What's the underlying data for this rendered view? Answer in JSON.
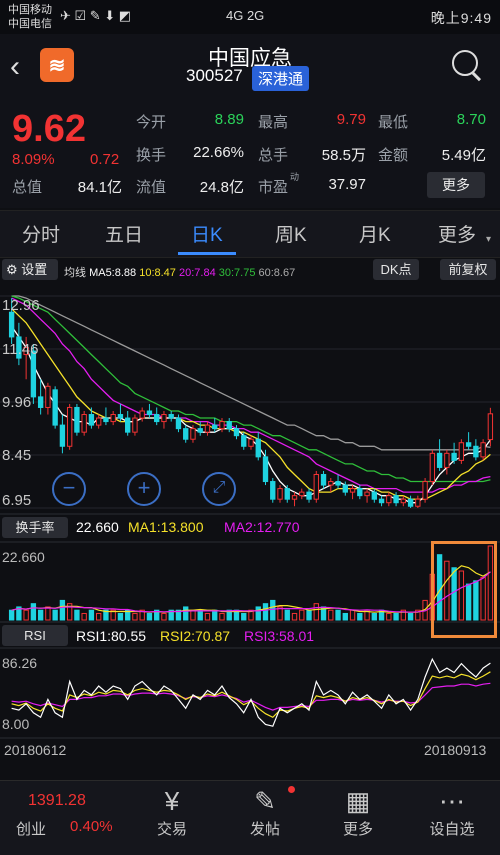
{
  "status_bar": {
    "carrier1": "中国移动",
    "carrier2": "中国电信",
    "time": "晚上9:49",
    "signal": "4G  2G",
    "icons": "✈ ☑ ✎ ⬇ ◩"
  },
  "header": {
    "stock_name": "中国应急",
    "stock_code": "300527",
    "badge": "深港通",
    "logo_text": "≋"
  },
  "quote": {
    "price": "9.62",
    "change_pct": "8.09%",
    "change": "0.72",
    "fields": [
      {
        "label": "今开",
        "value": "8.89",
        "color": "green"
      },
      {
        "label": "最高",
        "value": "9.79",
        "color": "red"
      },
      {
        "label": "最低",
        "value": "8.70",
        "color": "green"
      },
      {
        "label": "换手",
        "value": "22.66%",
        "color": ""
      },
      {
        "label": "总手",
        "value": "58.5万",
        "color": ""
      },
      {
        "label": "金额",
        "value": "5.49亿",
        "color": ""
      },
      {
        "label": "总值",
        "value": "84.1亿",
        "color": ""
      },
      {
        "label": "流值",
        "value": "24.8亿",
        "color": ""
      },
      {
        "label": "市盈",
        "value": "37.97",
        "color": ""
      }
    ],
    "pe_sup": "动",
    "more_button": "更多"
  },
  "tabs": [
    "分时",
    "五日",
    "日K",
    "周K",
    "月K",
    "更多"
  ],
  "active_tab": "日K",
  "ma_bar": {
    "settings": "设置",
    "legend_label": "均线",
    "ma5": "MA5:8.88",
    "ma10": "10:8.47",
    "ma20": "20:7.84",
    "ma30": "30:7.75",
    "ma60": "60:8.67",
    "dk_button": "DK点",
    "fq_button": "前复权"
  },
  "colors": {
    "ma5": "#ffffff",
    "ma10": "#f5e12a",
    "ma20": "#e41ef0",
    "ma30": "#2fbf3a",
    "ma60": "#9a9a9a",
    "up": "#f23333",
    "down": "#1fd3e0",
    "highlight": "#f08a3a"
  },
  "main_chart": {
    "y_labels": [
      "12.96",
      "11.46",
      "9.96",
      "8.45",
      "6.95"
    ]
  },
  "turnover": {
    "button": "换手率",
    "value": "22.660",
    "ma1": "MA1:13.800",
    "ma2": "MA2:12.770",
    "y_label": "22.660"
  },
  "rsi": {
    "button": "RSI",
    "rsi1": "RSI1:80.55",
    "rsi2": "RSI2:70.87",
    "rsi3": "RSI3:58.01",
    "y_top": "86.26",
    "y_bottom": "8.00"
  },
  "dates": {
    "start": "20180612",
    "end": "20180913"
  },
  "bottom_nav": {
    "index_value": "1391.28",
    "index_name": "创业",
    "index_pct": "0.40%",
    "items": [
      {
        "label": "交易",
        "icon": "¥"
      },
      {
        "label": "发帖",
        "icon": "✎"
      },
      {
        "label": "更多",
        "icon": "▦"
      },
      {
        "label": "设自选",
        "icon": "⋯"
      }
    ]
  },
  "chart_data": {
    "type": "candlestick",
    "title": "",
    "ylim": [
      6.95,
      12.96
    ],
    "candles": [
      [
        12.5,
        12.9,
        11.6,
        11.8
      ],
      [
        11.8,
        12.2,
        11.0,
        11.2
      ],
      [
        11.3,
        11.8,
        10.6,
        11.5
      ],
      [
        11.4,
        11.6,
        9.9,
        10.1
      ],
      [
        10.1,
        10.6,
        9.6,
        9.8
      ],
      [
        9.8,
        10.5,
        9.6,
        10.4
      ],
      [
        10.3,
        10.4,
        9.2,
        9.3
      ],
      [
        9.3,
        9.6,
        8.5,
        8.7
      ],
      [
        8.7,
        9.9,
        8.6,
        9.8
      ],
      [
        9.8,
        9.9,
        9.0,
        9.1
      ],
      [
        9.1,
        9.7,
        9.0,
        9.6
      ],
      [
        9.6,
        9.8,
        9.2,
        9.3
      ],
      [
        9.3,
        9.6,
        9.2,
        9.5
      ],
      [
        9.5,
        9.8,
        9.3,
        9.4
      ],
      [
        9.4,
        9.7,
        9.3,
        9.6
      ],
      [
        9.6,
        9.9,
        9.4,
        9.5
      ],
      [
        9.5,
        9.7,
        9.0,
        9.1
      ],
      [
        9.1,
        9.6,
        9.0,
        9.5
      ],
      [
        9.5,
        9.8,
        9.4,
        9.7
      ],
      [
        9.7,
        9.9,
        9.5,
        9.6
      ],
      [
        9.6,
        9.8,
        9.3,
        9.4
      ],
      [
        9.4,
        9.7,
        9.2,
        9.6
      ],
      [
        9.6,
        9.7,
        9.4,
        9.5
      ],
      [
        9.5,
        9.6,
        9.1,
        9.2
      ],
      [
        9.2,
        9.3,
        8.8,
        8.9
      ],
      [
        8.9,
        9.3,
        8.8,
        9.2
      ],
      [
        9.2,
        9.4,
        9.0,
        9.1
      ],
      [
        9.1,
        9.4,
        9.0,
        9.3
      ],
      [
        9.3,
        9.5,
        9.1,
        9.2
      ],
      [
        9.2,
        9.5,
        9.1,
        9.4
      ],
      [
        9.4,
        9.5,
        9.1,
        9.2
      ],
      [
        9.2,
        9.3,
        8.9,
        9.0
      ],
      [
        9.0,
        9.1,
        8.6,
        8.7
      ],
      [
        8.7,
        9.0,
        8.6,
        8.9
      ],
      [
        8.9,
        9.1,
        8.3,
        8.4
      ],
      [
        8.4,
        8.6,
        7.6,
        7.7
      ],
      [
        7.7,
        7.8,
        7.1,
        7.2
      ],
      [
        7.2,
        7.6,
        7.1,
        7.5
      ],
      [
        7.5,
        7.6,
        7.1,
        7.2
      ],
      [
        7.2,
        7.4,
        7.0,
        7.3
      ],
      [
        7.3,
        7.5,
        7.2,
        7.4
      ],
      [
        7.4,
        7.5,
        7.1,
        7.2
      ],
      [
        7.2,
        8.0,
        7.1,
        7.9
      ],
      [
        7.9,
        8.0,
        7.5,
        7.6
      ],
      [
        7.6,
        7.8,
        7.4,
        7.7
      ],
      [
        7.7,
        7.9,
        7.5,
        7.6
      ],
      [
        7.6,
        7.7,
        7.3,
        7.4
      ],
      [
        7.4,
        7.6,
        7.2,
        7.5
      ],
      [
        7.5,
        7.6,
        7.2,
        7.3
      ],
      [
        7.3,
        7.5,
        7.1,
        7.4
      ],
      [
        7.4,
        7.5,
        7.1,
        7.2
      ],
      [
        7.2,
        7.3,
        7.0,
        7.1
      ],
      [
        7.1,
        7.4,
        7.0,
        7.3
      ],
      [
        7.3,
        7.4,
        7.0,
        7.1
      ],
      [
        7.1,
        7.3,
        7.0,
        7.2
      ],
      [
        7.2,
        7.3,
        6.95,
        7.0
      ],
      [
        7.0,
        7.3,
        6.95,
        7.2
      ],
      [
        7.2,
        7.8,
        7.1,
        7.7
      ],
      [
        7.7,
        8.6,
        7.6,
        8.5
      ],
      [
        8.5,
        8.9,
        8.0,
        8.1
      ],
      [
        8.1,
        8.6,
        7.9,
        8.5
      ],
      [
        8.5,
        8.8,
        8.2,
        8.3
      ],
      [
        8.3,
        8.9,
        8.2,
        8.8
      ],
      [
        8.8,
        9.1,
        8.6,
        8.7
      ],
      [
        8.7,
        8.9,
        8.3,
        8.4
      ],
      [
        8.4,
        8.9,
        8.3,
        8.8
      ],
      [
        8.89,
        9.79,
        8.7,
        9.62
      ]
    ],
    "ma5": [
      12.1,
      11.8,
      11.5,
      11.0,
      10.6,
      10.2,
      9.9,
      9.6,
      9.5,
      9.4,
      9.4,
      9.3,
      9.5,
      9.5,
      9.5,
      9.5,
      9.4,
      9.4,
      9.5,
      9.5,
      9.5,
      9.5,
      9.5,
      9.5,
      9.3,
      9.2,
      9.1,
      9.1,
      9.1,
      9.2,
      9.2,
      9.2,
      9.0,
      8.9,
      8.7,
      8.4,
      8.0,
      7.7,
      7.5,
      7.4,
      7.3,
      7.3,
      7.4,
      7.5,
      7.6,
      7.7,
      7.6,
      7.6,
      7.5,
      7.5,
      7.4,
      7.3,
      7.3,
      7.2,
      7.2,
      7.1,
      7.1,
      7.3,
      7.6,
      7.9,
      8.1,
      8.3,
      8.4,
      8.5,
      8.5,
      8.6,
      8.88
    ],
    "ma10": [
      12.6,
      12.4,
      12.2,
      11.9,
      11.6,
      11.3,
      11.0,
      10.7,
      10.4,
      10.1,
      9.9,
      9.7,
      9.6,
      9.5,
      9.5,
      9.4,
      9.4,
      9.4,
      9.5,
      9.5,
      9.5,
      9.5,
      9.5,
      9.5,
      9.4,
      9.4,
      9.3,
      9.3,
      9.2,
      9.2,
      9.2,
      9.1,
      9.1,
      9.0,
      8.9,
      8.8,
      8.6,
      8.4,
      8.1,
      7.9,
      7.7,
      7.5,
      7.4,
      7.4,
      7.4,
      7.5,
      7.5,
      7.5,
      7.5,
      7.5,
      7.5,
      7.4,
      7.4,
      7.3,
      7.3,
      7.2,
      7.2,
      7.2,
      7.3,
      7.4,
      7.5,
      7.7,
      7.9,
      8.0,
      8.2,
      8.3,
      8.47
    ],
    "ma20": [
      12.9,
      12.8,
      12.7,
      12.5,
      12.3,
      12.1,
      11.9,
      11.6,
      11.4,
      11.1,
      10.9,
      10.6,
      10.4,
      10.2,
      10.0,
      9.9,
      9.8,
      9.7,
      9.6,
      9.6,
      9.6,
      9.5,
      9.5,
      9.5,
      9.5,
      9.4,
      9.4,
      9.4,
      9.3,
      9.3,
      9.3,
      9.2,
      9.2,
      9.1,
      9.1,
      9.0,
      8.9,
      8.8,
      8.7,
      8.6,
      8.5,
      8.4,
      8.2,
      8.1,
      8.0,
      7.9,
      7.8,
      7.7,
      7.6,
      7.6,
      7.5,
      7.5,
      7.5,
      7.5,
      7.4,
      7.4,
      7.4,
      7.4,
      7.4,
      7.5,
      7.5,
      7.6,
      7.6,
      7.7,
      7.7,
      7.8,
      7.84
    ],
    "ma30": [
      12.96,
      12.9,
      12.8,
      12.7,
      12.6,
      12.5,
      12.3,
      12.1,
      11.9,
      11.7,
      11.5,
      11.3,
      11.1,
      10.9,
      10.7,
      10.5,
      10.4,
      10.2,
      10.1,
      10.0,
      9.9,
      9.8,
      9.7,
      9.7,
      9.6,
      9.6,
      9.5,
      9.5,
      9.5,
      9.4,
      9.4,
      9.4,
      9.3,
      9.3,
      9.2,
      9.1,
      9.0,
      9.0,
      8.9,
      8.8,
      8.7,
      8.6,
      8.6,
      8.5,
      8.4,
      8.3,
      8.2,
      8.2,
      8.1,
      8.0,
      8.0,
      7.9,
      7.9,
      7.8,
      7.8,
      7.7,
      7.7,
      7.7,
      7.7,
      7.7,
      7.7,
      7.7,
      7.7,
      7.7,
      7.7,
      7.7,
      7.75
    ],
    "ma60": [
      12.96,
      12.96,
      12.9,
      12.8,
      12.7,
      12.6,
      12.5,
      12.4,
      12.3,
      12.2,
      12.1,
      12.0,
      11.9,
      11.8,
      11.7,
      11.6,
      11.5,
      11.4,
      11.3,
      11.2,
      11.1,
      11.0,
      10.9,
      10.8,
      10.7,
      10.6,
      10.5,
      10.4,
      10.3,
      10.2,
      10.1,
      10.0,
      9.9,
      9.8,
      9.7,
      9.6,
      9.5,
      9.4,
      9.3,
      9.3,
      9.2,
      9.1,
      9.0,
      9.0,
      8.9,
      8.9,
      8.8,
      8.8,
      8.7,
      8.7,
      8.7,
      8.6,
      8.6,
      8.6,
      8.6,
      8.6,
      8.6,
      8.6,
      8.6,
      8.6,
      8.6,
      8.6,
      8.6,
      8.6,
      8.6,
      8.7,
      8.67
    ],
    "turnover": [
      3,
      4,
      3,
      5,
      3,
      4,
      3,
      6,
      5,
      3,
      2,
      3,
      2,
      3,
      3,
      2,
      3,
      2,
      3,
      2,
      3,
      2,
      3,
      3,
      4,
      3,
      3,
      2,
      3,
      2,
      3,
      3,
      2,
      3,
      4,
      5,
      6,
      4,
      3,
      2,
      3,
      3,
      5,
      4,
      3,
      3,
      2,
      3,
      2,
      3,
      2,
      3,
      2,
      2,
      3,
      2,
      3,
      6,
      14,
      20,
      18,
      16,
      15,
      11,
      12,
      13,
      22.66
    ],
    "rsi1": [
      30,
      28,
      35,
      25,
      20,
      40,
      25,
      20,
      60,
      40,
      50,
      45,
      55,
      48,
      55,
      52,
      40,
      55,
      60,
      52,
      45,
      55,
      50,
      40,
      30,
      45,
      40,
      50,
      45,
      55,
      42,
      35,
      25,
      40,
      20,
      12,
      10,
      30,
      25,
      30,
      35,
      28,
      60,
      45,
      50,
      45,
      35,
      48,
      40,
      45,
      38,
      30,
      45,
      35,
      40,
      28,
      40,
      65,
      85,
      70,
      75,
      70,
      80,
      72,
      65,
      75,
      80.55
    ],
    "rsi2": [
      35,
      33,
      36,
      30,
      27,
      35,
      30,
      27,
      45,
      42,
      46,
      44,
      48,
      46,
      50,
      49,
      45,
      50,
      52,
      50,
      48,
      50,
      49,
      45,
      40,
      44,
      42,
      46,
      44,
      48,
      44,
      40,
      34,
      38,
      30,
      24,
      20,
      28,
      27,
      30,
      32,
      30,
      44,
      42,
      44,
      42,
      38,
      42,
      40,
      42,
      39,
      35,
      40,
      37,
      38,
      33,
      37,
      52,
      66,
      64,
      66,
      64,
      68,
      66,
      62,
      66,
      70.87
    ],
    "rsi3": [
      38,
      37,
      38,
      35,
      33,
      36,
      34,
      32,
      40,
      40,
      42,
      42,
      44,
      44,
      46,
      46,
      44,
      46,
      47,
      47,
      46,
      47,
      46,
      44,
      41,
      43,
      42,
      44,
      43,
      45,
      43,
      41,
      37,
      39,
      35,
      31,
      28,
      31,
      31,
      32,
      33,
      32,
      39,
      39,
      40,
      40,
      38,
      40,
      39,
      40,
      39,
      37,
      39,
      38,
      38,
      36,
      37,
      45,
      53,
      54,
      55,
      55,
      57,
      57,
      55,
      57,
      58.01
    ]
  }
}
